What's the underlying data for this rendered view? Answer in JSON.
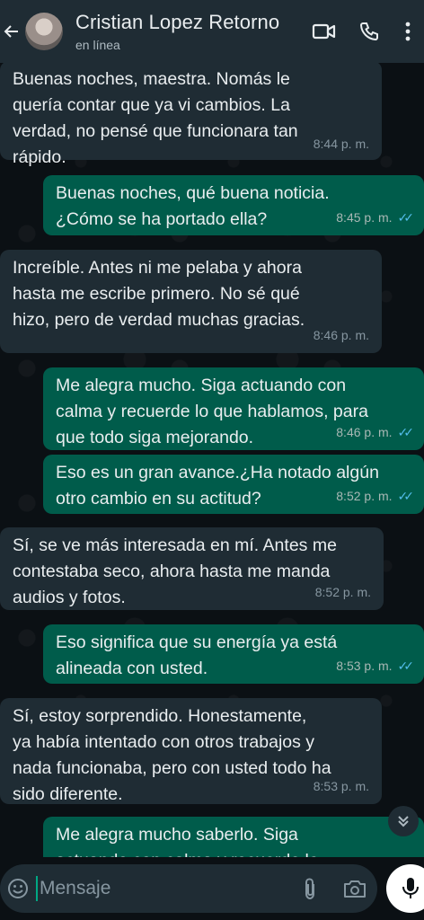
{
  "header": {
    "contact_name": "Cristian Lopez Retorno",
    "status": "en línea"
  },
  "messages": [
    {
      "direction": "in",
      "lines": [
        "Buenas noches, maestra. Nomás le",
        "quería contar que ya vi cambios. La",
        "verdad, no pensé que funcionara tan",
        "rápido."
      ],
      "time": "8:44 p. m."
    },
    {
      "direction": "out",
      "lines": [
        "Buenas noches, qué buena noticia.",
        "¿Cómo se ha portado ella?"
      ],
      "time": "8:45 p. m.",
      "read": true
    },
    {
      "direction": "in",
      "lines": [
        "Increíble. Antes ni me pelaba y ahora",
        "hasta me escribe primero. No sé qué",
        "hizo, pero de verdad muchas gracias."
      ],
      "time": "8:46 p. m."
    },
    {
      "direction": "out",
      "lines": [
        "Me alegra mucho. Siga actuando con",
        "calma y recuerde lo que hablamos, para",
        "que todo siga mejorando."
      ],
      "time": "8:46 p. m.",
      "read": true
    },
    {
      "direction": "out",
      "lines": [
        "Eso es un gran avance.¿Ha notado algún",
        "otro cambio en su actitud?"
      ],
      "time": "8:52 p. m.",
      "read": true
    },
    {
      "direction": "in",
      "lines": [
        "Sí, se ve más interesada en mí. Antes me",
        "contestaba seco, ahora hasta me manda",
        "audios y fotos."
      ],
      "time": "8:52 p. m."
    },
    {
      "direction": "out",
      "lines": [
        "Eso significa que su energía ya está",
        "alineada con usted."
      ],
      "time": "8:53 p. m.",
      "read": true
    },
    {
      "direction": "in",
      "lines": [
        "Sí, estoy sorprendido. Honestamente,",
        "ya había intentado con otros trabajos y",
        "nada funcionaba, pero con usted todo ha",
        "sido diferente."
      ],
      "time": "8:53 p. m."
    },
    {
      "direction": "out",
      "lines": [
        "Me alegra mucho saberlo. Siga",
        "actuando con calma y recuerde lo"
      ],
      "time": "",
      "read": false
    }
  ],
  "composer": {
    "placeholder": "Mensaje"
  },
  "icons": {
    "back": "back-arrow-icon",
    "video": "video-call-icon",
    "call": "phone-icon",
    "menu": "more-vert-icon",
    "emoji": "emoji-icon",
    "attach": "paperclip-icon",
    "camera": "camera-icon",
    "mic": "mic-icon",
    "scroll": "double-chevron-down-icon"
  },
  "colors": {
    "header_bg": "#1f2c34",
    "incoming_bubble": "#1f2c34",
    "outgoing_bubble": "#005c4b",
    "read_ticks": "#53bdeb"
  }
}
